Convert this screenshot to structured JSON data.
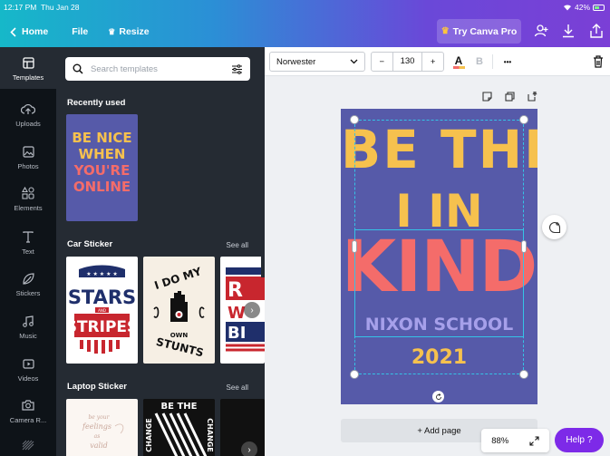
{
  "status_bar": {
    "time": "12:17 PM",
    "date": "Thu Jan 28",
    "battery": "42%"
  },
  "nav": {
    "home": "Home",
    "file": "File",
    "resize": "Resize",
    "try_pro": "Try Canva Pro"
  },
  "rail": [
    {
      "label": "Templates",
      "icon": "templates-icon"
    },
    {
      "label": "Uploads",
      "icon": "upload-icon"
    },
    {
      "label": "Photos",
      "icon": "photo-icon"
    },
    {
      "label": "Elements",
      "icon": "elements-icon"
    },
    {
      "label": "Text",
      "icon": "text-icon"
    },
    {
      "label": "Stickers",
      "icon": "sticker-icon"
    },
    {
      "label": "Music",
      "icon": "music-icon"
    },
    {
      "label": "Videos",
      "icon": "video-icon"
    },
    {
      "label": "Camera R...",
      "icon": "camera-icon"
    }
  ],
  "panel": {
    "search_placeholder": "Search templates",
    "sections": [
      {
        "title": "Recently used"
      },
      {
        "title": "Car Sticker",
        "see_all": "See all"
      },
      {
        "title": "Laptop Sticker",
        "see_all": "See all"
      }
    ],
    "recent_thumb": [
      "BE NICE",
      "WHEN",
      "YOU'RE",
      "ONLINE"
    ],
    "car_stickers": {
      "first": [
        "STARS",
        "AND",
        "STRIPES"
      ],
      "second": [
        "I DO MY",
        "OWN",
        "STUNTS"
      ],
      "third": [
        "R",
        "W",
        "BI"
      ]
    },
    "laptop_stickers": {
      "first": [
        "be your",
        "feelings",
        "as",
        "valid"
      ],
      "second": [
        "BE THE",
        "CHANGE"
      ]
    }
  },
  "toolbar": {
    "font": "Norwester",
    "minus": "−",
    "size": "130",
    "plus": "+",
    "color_letter": "A",
    "bold": "B",
    "more": "•••"
  },
  "design": {
    "line1": "BE THE",
    "line2": "I IN",
    "line3": "KIND",
    "line4": "NIXON SCHOOL",
    "line5": "2021"
  },
  "canvas": {
    "add_page": "+ Add page",
    "zoom": "88%",
    "help": "Help",
    "help_mark": "?"
  },
  "colors": {
    "accent": "#7d2ae8",
    "design_bg": "#565aa9",
    "yellow": "#f6c14e",
    "coral": "#f46c6a",
    "lavender": "#a6a0ea",
    "selection": "#35c3e6"
  }
}
